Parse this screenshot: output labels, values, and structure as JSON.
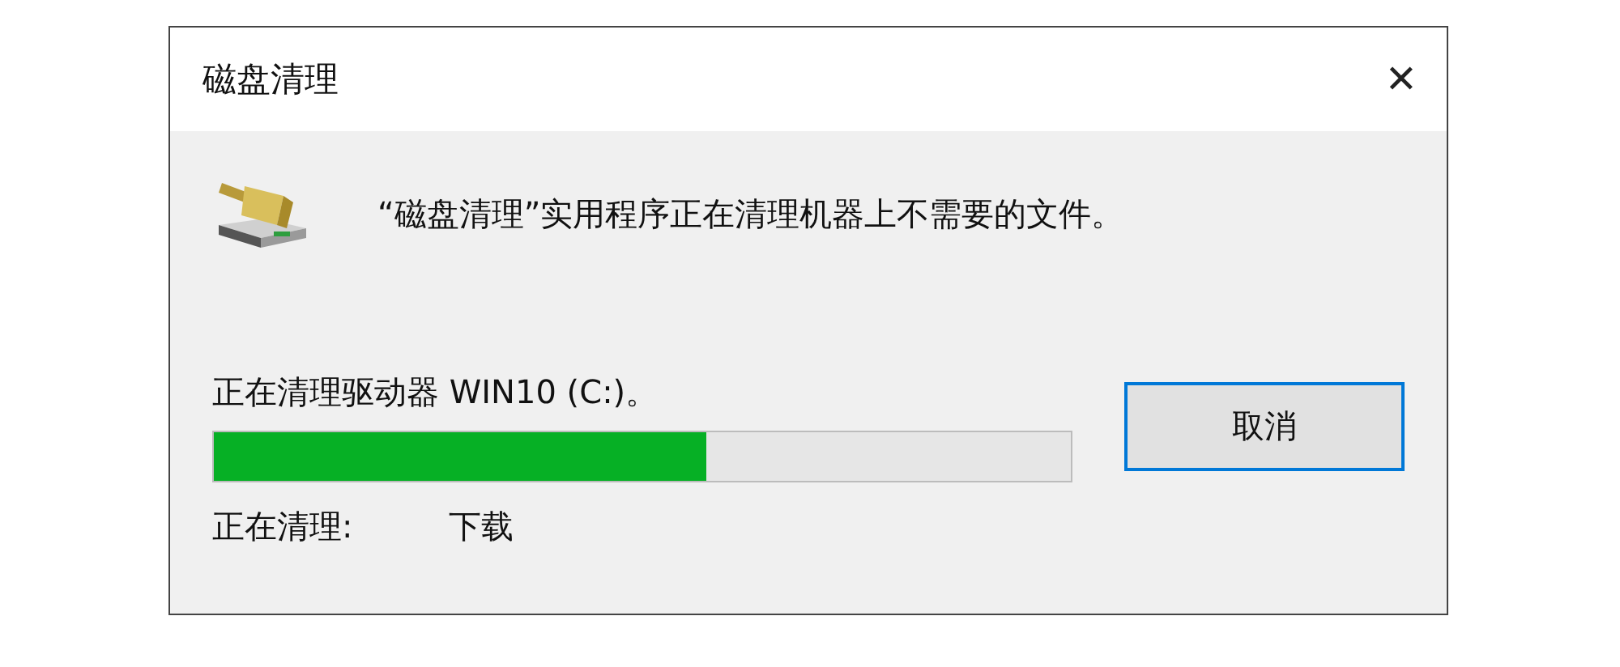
{
  "window": {
    "title": "磁盘清理",
    "close": "✕"
  },
  "message": "“磁盘清理”实用程序正在清理机器上不需要的文件。",
  "status": "正在清理驱动器 WIN10 (C:)。",
  "progress": {
    "level": 0.575
  },
  "current": {
    "label": "正在清理:",
    "value": "下载"
  },
  "buttons": [
    {
      "label": "取消",
      "focused": true
    }
  ]
}
